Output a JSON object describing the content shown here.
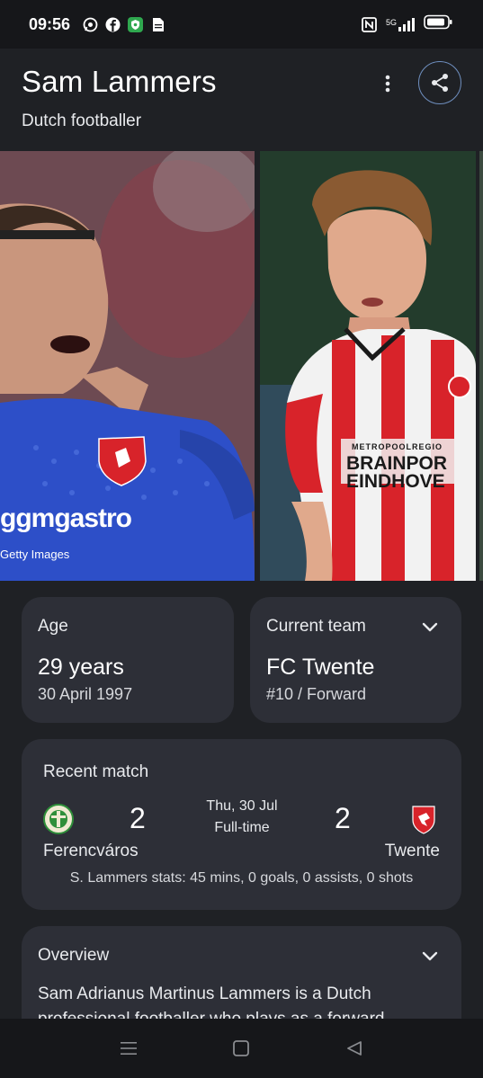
{
  "status_bar": {
    "time": "09:56",
    "notification_icons": [
      "whatsapp-icon",
      "facebook-icon",
      "shield-app-icon",
      "document-icon"
    ],
    "right_icons": [
      "nfc-icon",
      "signal-5g-icon",
      "battery-icon"
    ],
    "network_label": "5G"
  },
  "header": {
    "title": "Sam Lammers",
    "subtitle": "Dutch footballer"
  },
  "gallery": {
    "credit": "Getty Images",
    "photo1_shirt_text": "ggmgastro",
    "photo2_shirt_text_1": "METROPOOLREGIO",
    "photo2_shirt_text_2": "BRAINPOR",
    "photo2_shirt_text_3": "EINDHOVE",
    "photo2_badge": "PSV",
    "photo1_badge": "FC TWENTE"
  },
  "age": {
    "label": "Age",
    "value": "29 years",
    "birth_date": "30 April 1997"
  },
  "current_team": {
    "label": "Current team",
    "value": "FC Twente",
    "detail": "#10 / Forward"
  },
  "recent_match": {
    "label": "Recent match",
    "home_team": "Ferencváros",
    "home_score": "2",
    "away_team": "Twente",
    "away_score": "2",
    "date": "Thu, 30 Jul",
    "status": "Full-time",
    "stats": "S. Lammers stats: 45 mins, 0 goals, 0 assists, 0 shots"
  },
  "overview": {
    "label": "Overview",
    "text": "Sam Adrianus Martinus Lammers is a Dutch professional footballer who plays as a forward"
  },
  "colors": {
    "background": "#1f2125",
    "card": "#2d2f37",
    "accent_border": "#6f8fbf",
    "twente_red": "#d8232a",
    "ferencvaros_green": "#2f8f3a"
  }
}
